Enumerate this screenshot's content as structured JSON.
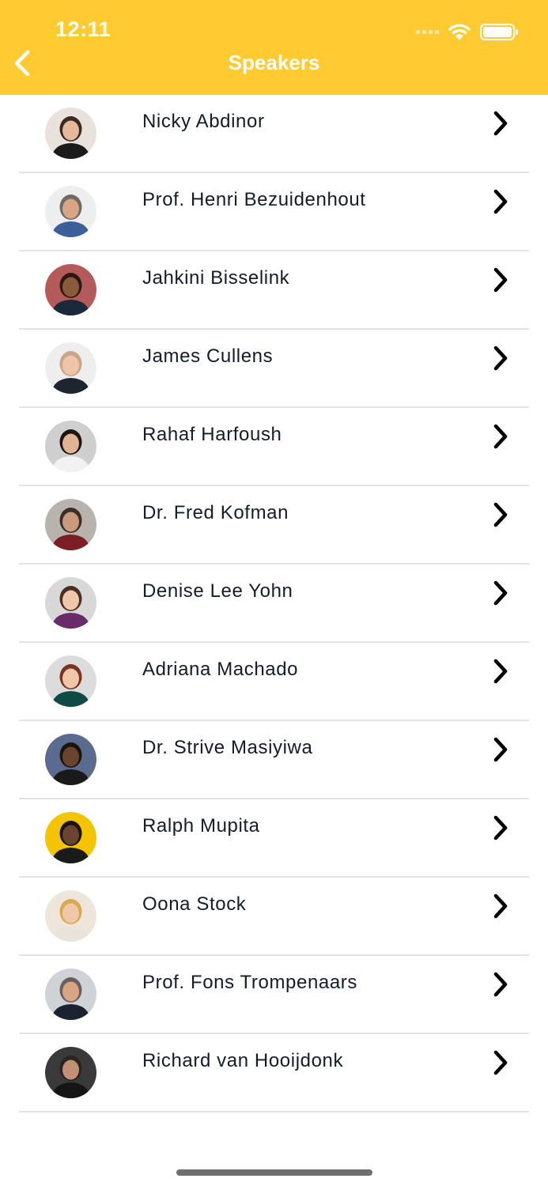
{
  "status_bar": {
    "time": "12:11"
  },
  "nav": {
    "title": "Speakers",
    "back_icon": "chevron-left-icon"
  },
  "colors": {
    "header": "#FFCB31",
    "text": "#131c2b",
    "separator": "#e3e3e3"
  },
  "speakers": [
    {
      "name": "Nicky Abdinor"
    },
    {
      "name": "Prof. Henri Bezuidenhout"
    },
    {
      "name": "Jahkini Bisselink"
    },
    {
      "name": "James Cullens"
    },
    {
      "name": "Rahaf Harfoush"
    },
    {
      "name": "Dr. Fred Kofman"
    },
    {
      "name": "Denise Lee Yohn"
    },
    {
      "name": "Adriana Machado"
    },
    {
      "name": "Dr. Strive Masiyiwa"
    },
    {
      "name": "Ralph Mupita"
    },
    {
      "name": "Oona Stock"
    },
    {
      "name": "Prof. Fons Trompenaars"
    },
    {
      "name": "Richard van Hooijdonk"
    }
  ]
}
